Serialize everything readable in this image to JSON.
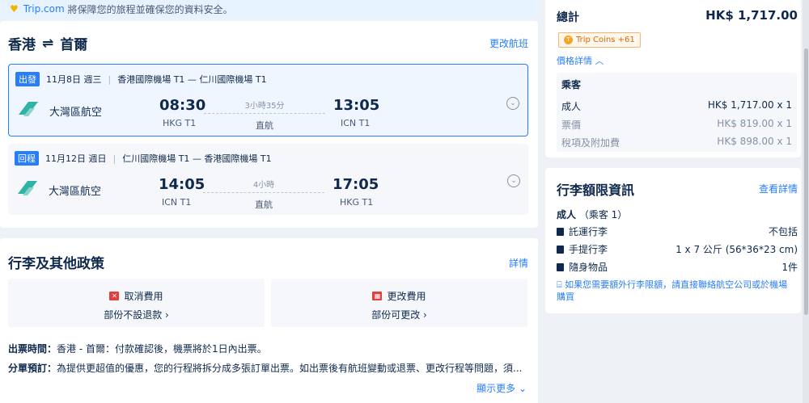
{
  "banner": {
    "brand": "Trip.com",
    "text": "將保障您的旅程並確保您的資料安全。"
  },
  "route": {
    "origin": "香港",
    "destination": "首爾",
    "arrows": "⇌",
    "change_label": "更改航班"
  },
  "segments": [
    {
      "tag": "出發",
      "date": "11月8日 週三",
      "route": "香港國際機場 T1 — 仁川國際機場 T1",
      "airline": "大灣區航空",
      "dep_time": "08:30",
      "dep_apt": "HKG T1",
      "duration": "3小時35分",
      "stops": "直航",
      "arr_time": "13:05",
      "arr_apt": "ICN T1"
    },
    {
      "tag": "回程",
      "date": "11月12日 週日",
      "route": "仁川國際機場 T1 — 香港國際機場 T1",
      "airline": "大灣區航空",
      "dep_time": "14:05",
      "dep_apt": "ICN T1",
      "duration": "4小時",
      "stops": "直航",
      "arr_time": "17:05",
      "arr_apt": "HKG T1"
    }
  ],
  "policy": {
    "title": "行李及其他政策",
    "detail_label": "詳情",
    "cancel": {
      "title": "取消費用",
      "sub": "部份不設退款 ›"
    },
    "change": {
      "title": "更改費用",
      "sub": "部份可更改 ›"
    },
    "ticketing_label": "出票時間：",
    "ticketing_text": "香港 - 首爾：付款確認後，機票將於1日內出票。",
    "split_label": "分單預訂：",
    "split_text": "為提供更超值的優惠，您的行程將拆分成多張訂單出票。如出票後有航班變動或退票、更改行程等問題，須...",
    "more_label": "顯示更多 ⌄"
  },
  "summary": {
    "total_label": "總計",
    "total_value": "HK$ 1,717.00",
    "coins": "Trip Coins +61",
    "coin_glyph": "T",
    "price_detail": "價格詳情 ︿",
    "pax_header": "乘客",
    "rows": [
      {
        "label": "成人",
        "value": "HK$ 1,717.00 x 1"
      },
      {
        "label": "票價",
        "value": "HK$ 819.00 x 1"
      },
      {
        "label": "稅項及附加費",
        "value": "HK$ 898.00 x 1"
      }
    ]
  },
  "baggage": {
    "title": "行李額限資訊",
    "link": "查看詳情",
    "pax_label": "成人",
    "pax_sub": "（乘客 1）",
    "rows": [
      {
        "label": "託運行李",
        "value": "不包括"
      },
      {
        "label": "手提行李",
        "value": "1 x 7 公斤 (56*36*23 cm)"
      },
      {
        "label": "隨身物品",
        "value": "1件"
      }
    ],
    "tip": "如果您需要額外行李限額，請直接聯絡航空公司或於機場購買"
  },
  "colors": {
    "accent": "#287dfa",
    "text": "#0f294d",
    "coin": "#f7a325"
  }
}
